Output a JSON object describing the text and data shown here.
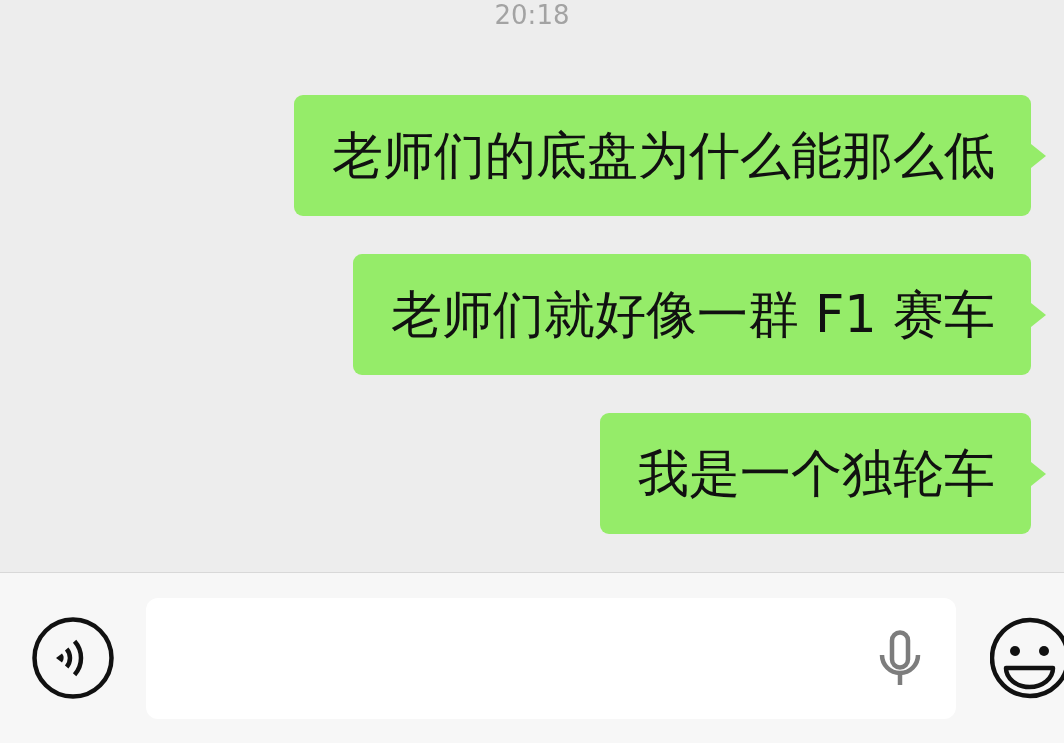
{
  "timestamp": "20:18",
  "messages": [
    {
      "text": "老师们的底盘为什么能那么低",
      "outgoing": true
    },
    {
      "text": "老师们就好像一群 F1 赛车",
      "outgoing": true
    },
    {
      "text": "我是一个独轮车",
      "outgoing": true
    }
  ]
}
